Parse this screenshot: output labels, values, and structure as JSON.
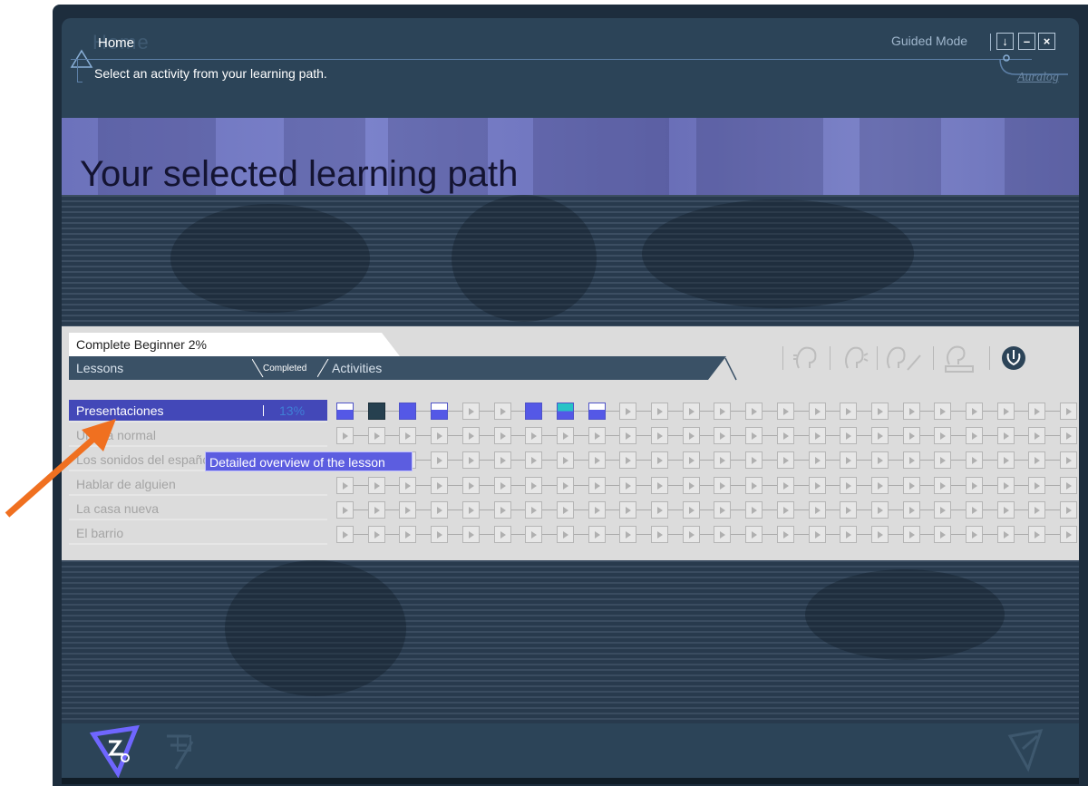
{
  "header": {
    "title": "Home",
    "subtitle": "Select an activity from your learning path.",
    "mode_label": "Guided Mode",
    "brand": "Auralog",
    "window_buttons": [
      "↓",
      "–",
      "×"
    ]
  },
  "banner": {
    "title": "Your selected learning path"
  },
  "course": {
    "title": "Complete Beginner 2%",
    "col_lessons": "Lessons",
    "col_completed": "Completed",
    "col_activities": "Activities"
  },
  "lessons": [
    {
      "label": "Presentaciones",
      "completed": "13%"
    },
    {
      "label": "Un día normal"
    },
    {
      "label": "Los sonidos del español"
    },
    {
      "label": "Hablar de alguien"
    },
    {
      "label": "La casa nueva"
    },
    {
      "label": "El barrio"
    }
  ],
  "activity_states_row1": [
    "half",
    "dark",
    "blue",
    "half",
    "play",
    "play",
    "blue",
    "teal",
    "half",
    "play",
    "play",
    "play",
    "play",
    "play",
    "play",
    "play",
    "play",
    "play",
    "play",
    "play",
    "play",
    "play",
    "play",
    "play"
  ],
  "tooltip": "Detailed overview of the lesson",
  "icons": [
    "listen-icon",
    "speak-icon",
    "write-icon",
    "dictation-icon",
    "exit-icon"
  ],
  "colors": {
    "accent": "#5458e6",
    "selected_row": "#4348b8",
    "panel": "#dcdcdc",
    "app_bg": "#2c4458",
    "arrow": "#f07020"
  }
}
